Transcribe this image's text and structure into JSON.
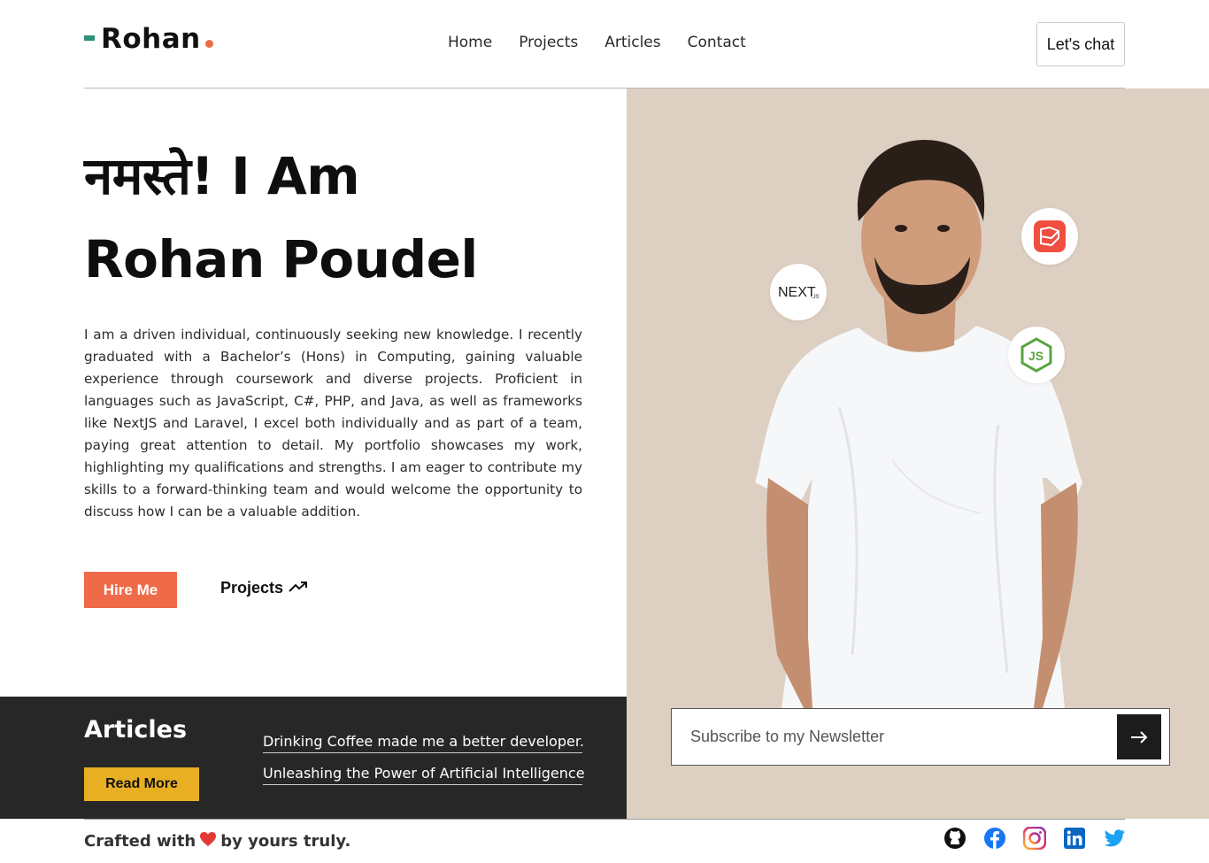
{
  "header": {
    "logo_text": "Rohan",
    "nav": [
      "Home",
      "Projects",
      "Articles",
      "Contact"
    ],
    "chat_label": "Let's chat"
  },
  "hero": {
    "title_line1": "नमस्ते! I Am",
    "title_line2": "Rohan Poudel",
    "bio": "I am a driven individual, continuously seeking new knowledge. I recently graduated with a Bachelor’s (Hons) in Computing, gaining valuable experience through coursework and diverse projects. Proficient in languages such as JavaScript, C#, PHP, and Java, as well as frameworks like NextJS and Laravel, I excel both individually and as part of a team, paying great attention to detail. My portfolio showcases my work, highlighting my qualifications and strengths. I am eager to contribute my skills to a forward-thinking team and would welcome the opportunity to discuss how I can be a valuable addition.",
    "hire_label": "Hire Me",
    "projects_label": "Projects",
    "tech_badges": [
      "nextjs-icon",
      "laravel-icon",
      "nodejs-icon"
    ]
  },
  "articles": {
    "title": "Articles",
    "read_more": "Read More",
    "items": [
      "Drinking Coffee made me a better developer.",
      "Unleashing the Power of Artificial Intelligence"
    ]
  },
  "newsletter": {
    "placeholder": "Subscribe to my Newsletter"
  },
  "footer": {
    "text_before": "Crafted with",
    "text_after": "by yours truly.",
    "socials": [
      "github-icon",
      "facebook-icon",
      "instagram-icon",
      "linkedin-icon",
      "twitter-icon"
    ]
  },
  "colors": {
    "accent": "#ef6a48",
    "panel": "#ddd0c2",
    "dark": "#272727",
    "yellow": "#e9af23",
    "logo_dash": "#2f8f7a"
  }
}
